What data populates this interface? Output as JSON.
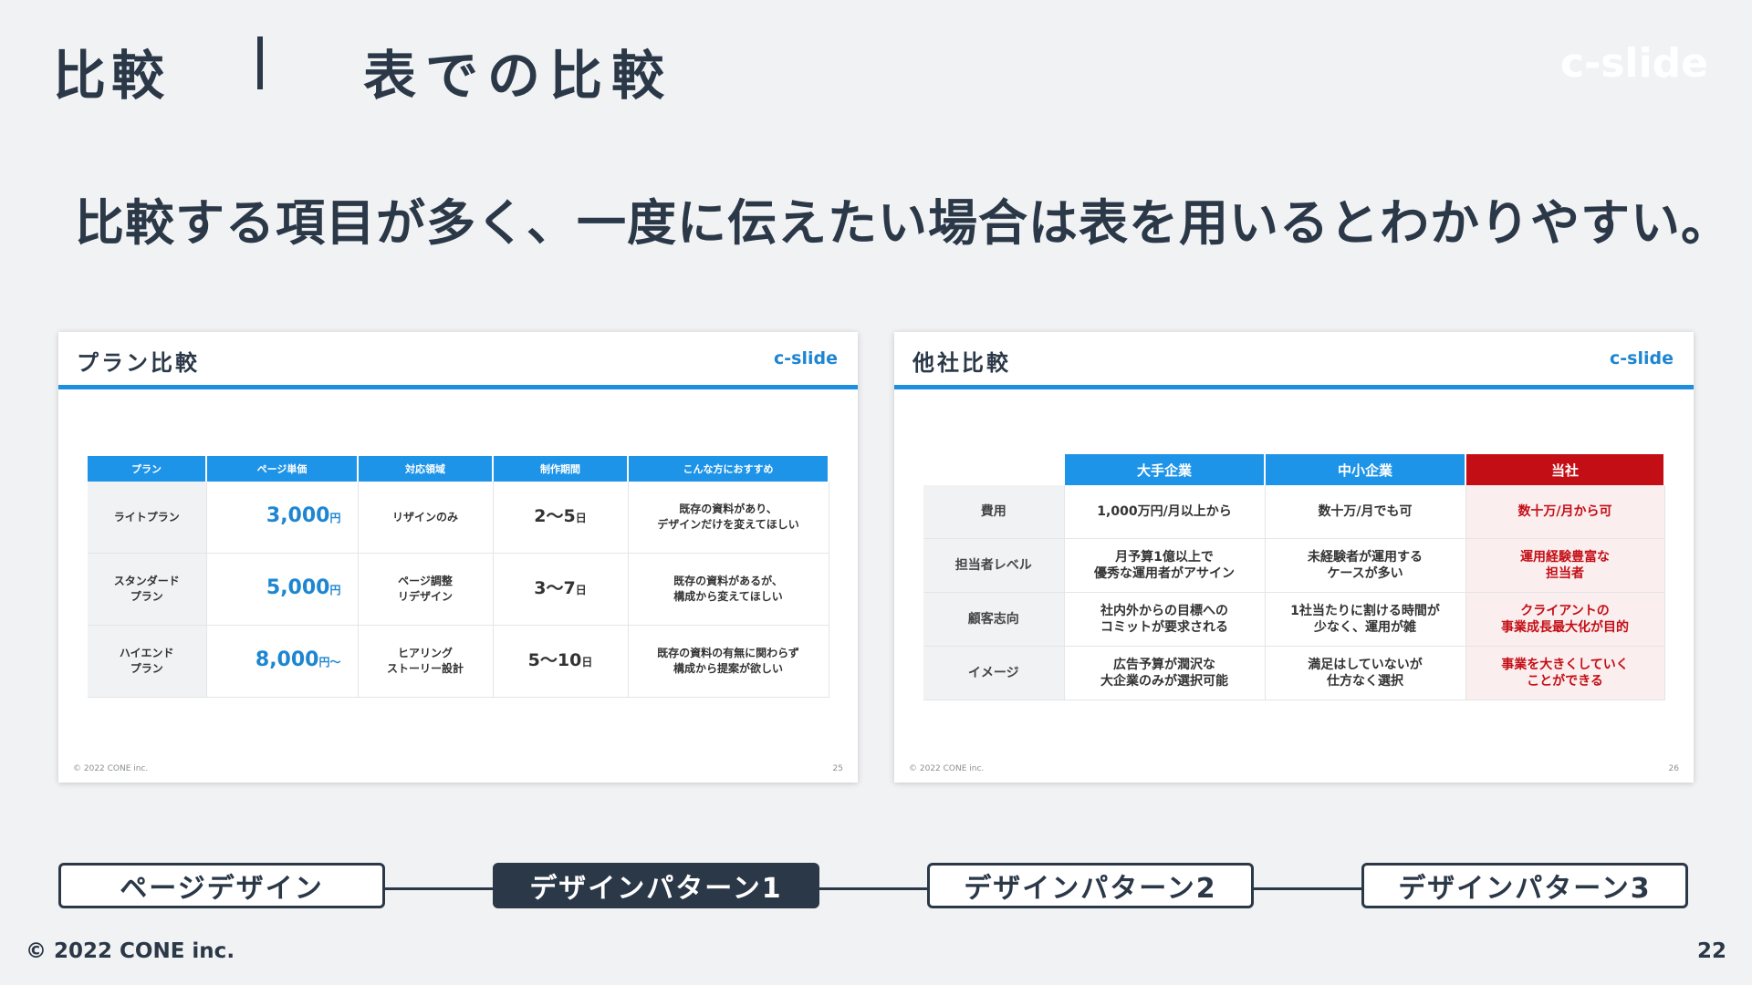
{
  "header": {
    "section": "比較",
    "subtitle": "表での比較",
    "brand": "c-slide"
  },
  "headline": "比較する項目が多く、一度に伝えたい場合は表を用いるとわかりやすい。",
  "slide1": {
    "title": "プラン比較",
    "brand": "c-slide",
    "columns": [
      "プラン",
      "ページ単価",
      "対応領域",
      "制作期間",
      "こんな方におすすめ"
    ],
    "rows": [
      {
        "plan": "ライトプラン",
        "price": "3,000",
        "price_unit": "円",
        "scope": "リザインのみ",
        "period": "2〜5",
        "period_unit": "日",
        "recommend": "既存の資料があり、\nデザインだけを変えてほしい"
      },
      {
        "plan": "スタンダード\nプラン",
        "price": "5,000",
        "price_unit": "円",
        "scope": "ページ調整\nリデザイン",
        "period": "3〜7",
        "period_unit": "日",
        "recommend": "既存の資料があるが、\n構成から変えてほしい"
      },
      {
        "plan": "ハイエンド\nプラン",
        "price": "8,000",
        "price_unit": "円〜",
        "scope": "ヒアリング\nストーリー設計",
        "period": "5〜10",
        "period_unit": "日",
        "recommend": "既存の資料の有無に関わらず\n構成から提案が欲しい"
      }
    ],
    "copyright": "© 2022 CONE inc.",
    "page": "25"
  },
  "slide2": {
    "title": "他社比較",
    "brand": "c-slide",
    "columns": [
      "",
      "大手企業",
      "中小企業",
      "当社"
    ],
    "rows": [
      {
        "label": "費用",
        "large": "1,000万円/月以上から",
        "small": "数十万/月でも可",
        "own": "数十万/月から可"
      },
      {
        "label": "担当者レベル",
        "large": "月予算1億以上で\n優秀な運用者がアサイン",
        "small": "未経験者が運用する\nケースが多い",
        "own": "運用経験豊富な\n担当者"
      },
      {
        "label": "顧客志向",
        "large": "社内外からの目標への\nコミットが要求される",
        "small": "1社当たりに割ける時間が\n少なく、運用が雑",
        "own": "クライアントの\n事業成長最大化が目的"
      },
      {
        "label": "イメージ",
        "large": "広告予算が潤沢な\n大企業のみが選択可能",
        "small": "満足はしていないが\n仕方なく選択",
        "own": "事業を大きくしていく\nことができる"
      }
    ],
    "copyright": "© 2022 CONE inc.",
    "page": "26"
  },
  "nav": {
    "items": [
      "ページデザイン",
      "デザインパターン1",
      "デザインパターン2",
      "デザインパターン3"
    ],
    "active_index": 1
  },
  "footer": {
    "copyright": "© 2022 CONE inc.",
    "page": "22"
  },
  "colors": {
    "navy": "#2b3848",
    "accent_blue": "#1e94e8",
    "accent_red": "#c40e16",
    "background": "#f1f2f3"
  }
}
